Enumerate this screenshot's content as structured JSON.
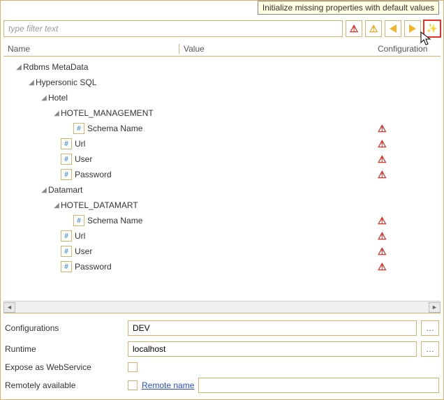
{
  "tooltip": "Initialize missing properties with default values",
  "filter": {
    "placeholder": "type filter text"
  },
  "table": {
    "headers": {
      "name": "Name",
      "value": "Value",
      "config": "Configuration"
    },
    "rows": [
      {
        "indent": 0,
        "twisty": "open",
        "icon": null,
        "label": "Rdbms MetaData",
        "warn": false
      },
      {
        "indent": 1,
        "twisty": "open",
        "icon": null,
        "label": "Hypersonic SQL",
        "warn": false
      },
      {
        "indent": 2,
        "twisty": "open",
        "icon": null,
        "label": "Hotel",
        "warn": false
      },
      {
        "indent": 3,
        "twisty": "open",
        "icon": null,
        "label": "HOTEL_MANAGEMENT",
        "warn": false
      },
      {
        "indent": 4,
        "twisty": "none",
        "icon": "prop",
        "label": "Schema Name",
        "warn": true
      },
      {
        "indent": 3,
        "twisty": "none",
        "icon": "prop",
        "label": "Url",
        "warn": true
      },
      {
        "indent": 3,
        "twisty": "none",
        "icon": "prop",
        "label": "User",
        "warn": true
      },
      {
        "indent": 3,
        "twisty": "none",
        "icon": "prop",
        "label": "Password",
        "warn": true
      },
      {
        "indent": 2,
        "twisty": "open",
        "icon": null,
        "label": "Datamart",
        "warn": false
      },
      {
        "indent": 3,
        "twisty": "open",
        "icon": null,
        "label": "HOTEL_DATAMART",
        "warn": false
      },
      {
        "indent": 4,
        "twisty": "none",
        "icon": "prop",
        "label": "Schema Name",
        "warn": true
      },
      {
        "indent": 3,
        "twisty": "none",
        "icon": "prop",
        "label": "Url",
        "warn": true
      },
      {
        "indent": 3,
        "twisty": "none",
        "icon": "prop",
        "label": "User",
        "warn": true
      },
      {
        "indent": 3,
        "twisty": "none",
        "icon": "prop",
        "label": "Password",
        "warn": true
      }
    ]
  },
  "form": {
    "configurations": {
      "label": "Configurations",
      "value": "DEV"
    },
    "runtime": {
      "label": "Runtime",
      "value": "localhost"
    },
    "expose": {
      "label": "Expose as WebService"
    },
    "remote": {
      "label": "Remotely available",
      "link": "Remote name"
    }
  }
}
